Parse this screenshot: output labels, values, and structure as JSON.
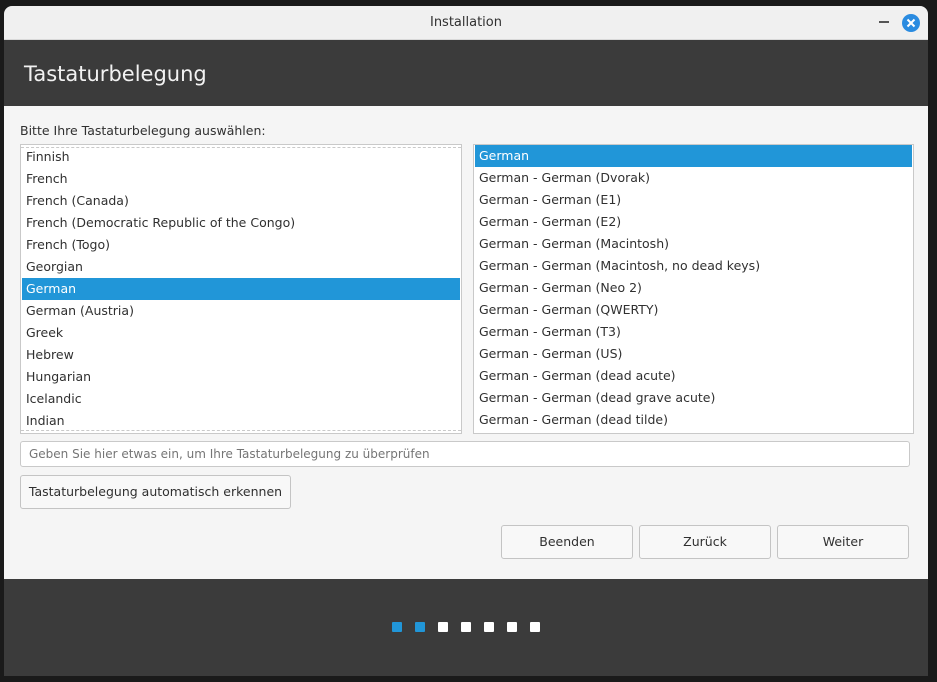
{
  "window": {
    "title": "Installation"
  },
  "header": {
    "title": "Tastaturbelegung"
  },
  "prompt": "Bitte Ihre Tastaturbelegung auswählen:",
  "layouts": {
    "items": [
      "Finnish",
      "French",
      "French (Canada)",
      "French (Democratic Republic of the Congo)",
      "French (Togo)",
      "Georgian",
      "German",
      "German (Austria)",
      "Greek",
      "Hebrew",
      "Hungarian",
      "Icelandic",
      "Indian"
    ],
    "selected": "German"
  },
  "variants": {
    "items": [
      "German",
      "German - German (Dvorak)",
      "German - German (E1)",
      "German - German (E2)",
      "German - German (Macintosh)",
      "German - German (Macintosh, no dead keys)",
      "German - German (Neo 2)",
      "German - German (QWERTY)",
      "German - German (T3)",
      "German - German (US)",
      "German - German (dead acute)",
      "German - German (dead grave acute)",
      "German - German (dead tilde)"
    ],
    "selected": "German"
  },
  "test_input": {
    "placeholder": "Geben Sie hier etwas ein, um Ihre Tastaturbelegung zu überprüfen",
    "value": ""
  },
  "buttons": {
    "detect": "Tastaturbelegung automatisch erkennen",
    "quit": "Beenden",
    "back": "Zurück",
    "next": "Weiter"
  },
  "progress": {
    "total_steps": 7,
    "completed_steps": 2
  },
  "colors": {
    "accent": "#2196d8",
    "header_bg": "#3b3b3b"
  }
}
